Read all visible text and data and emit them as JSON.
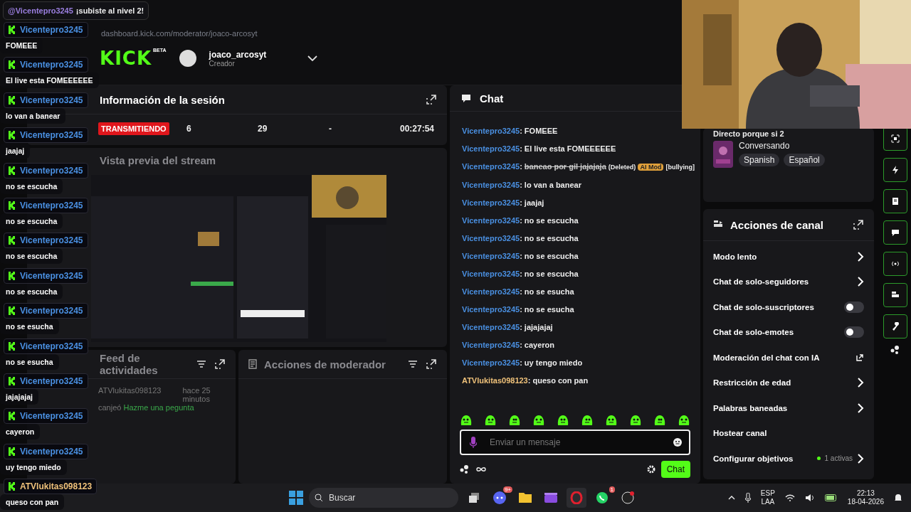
{
  "browser": {
    "url": "dashboard.kick.com/moderator/joaco-arcosyt"
  },
  "header": {
    "logo": "KICK",
    "logo_badge": "BETA",
    "user": {
      "name": "joaco_arcosyt",
      "role": "Creador"
    }
  },
  "session": {
    "title": "Información de la sesión",
    "status": "TRANSMITIENDO",
    "stats": [
      "6",
      "29",
      "-",
      "00:27:54"
    ]
  },
  "preview": {
    "title": "Vista previa del stream"
  },
  "activity": {
    "title": "Feed de actividades",
    "events": [
      {
        "user": "ATVlukitas098123",
        "time": "hace 25 minutos",
        "action": "canjeó",
        "reward": "Hazme una pegunta"
      }
    ]
  },
  "mod_actions": {
    "title": "Acciones de moderador"
  },
  "chat": {
    "title": "Chat",
    "separator": ":",
    "messages": [
      {
        "user": "Vicentepro3245",
        "color": "#4a90e2",
        "text": "FOMEEE",
        "deleted": false
      },
      {
        "user": "Vicentepro3245",
        "color": "#4a90e2",
        "text": "El live esta FOMEEEEEE",
        "deleted": false
      },
      {
        "user": "Vicentepro3245",
        "color": "#4a90e2",
        "text": "baneao por gil jajajaja",
        "deleted": true,
        "deleted_label": "(Deleted)",
        "badge": "AI Mod",
        "reason": "[bullying]"
      },
      {
        "user": "Vicentepro3245",
        "color": "#4a90e2",
        "text": "lo van a banear",
        "deleted": false
      },
      {
        "user": "Vicentepro3245",
        "color": "#4a90e2",
        "text": "jaajaj",
        "deleted": false
      },
      {
        "user": "Vicentepro3245",
        "color": "#4a90e2",
        "text": "no se escucha",
        "deleted": false
      },
      {
        "user": "Vicentepro3245",
        "color": "#4a90e2",
        "text": "no se escucha",
        "deleted": false
      },
      {
        "user": "Vicentepro3245",
        "color": "#4a90e2",
        "text": "no se escucha",
        "deleted": false
      },
      {
        "user": "Vicentepro3245",
        "color": "#4a90e2",
        "text": "no se escucha",
        "deleted": false
      },
      {
        "user": "Vicentepro3245",
        "color": "#4a90e2",
        "text": "no se esucha",
        "deleted": false
      },
      {
        "user": "Vicentepro3245",
        "color": "#4a90e2",
        "text": "no se esucha",
        "deleted": false
      },
      {
        "user": "Vicentepro3245",
        "color": "#4a90e2",
        "text": "jajajajaj",
        "deleted": false
      },
      {
        "user": "Vicentepro3245",
        "color": "#4a90e2",
        "text": "cayeron",
        "deleted": false
      },
      {
        "user": "Vicentepro3245",
        "color": "#4a90e2",
        "text": "uy tengo miedo",
        "deleted": false
      },
      {
        "user": "ATVlukitas098123",
        "color": "#f0c27a",
        "text": "queso con pan",
        "deleted": false
      }
    ],
    "input": {
      "placeholder": "Enviar un mensaje"
    },
    "send_label": "Chat"
  },
  "stream_info": {
    "title": "Directo porque si 2",
    "category": "Conversando",
    "tags": [
      "Spanish",
      "Español"
    ]
  },
  "channel_actions": {
    "title": "Acciones de canal",
    "items": [
      {
        "label": "Modo lento",
        "kind": "link"
      },
      {
        "label": "Chat de solo-seguidores",
        "kind": "link"
      },
      {
        "label": "Chat de solo-suscriptores",
        "kind": "toggle",
        "on": false
      },
      {
        "label": "Chat de solo-emotes",
        "kind": "toggle",
        "on": false
      },
      {
        "label": "Moderación del chat con IA",
        "kind": "external"
      },
      {
        "label": "Restricción de edad",
        "kind": "link"
      },
      {
        "label": "Palabras baneadas",
        "kind": "link"
      },
      {
        "label": "Hostear canal",
        "kind": "plain"
      },
      {
        "label": "Configurar objetivos",
        "kind": "goal",
        "note": "1 activas"
      }
    ]
  },
  "taskbar": {
    "search_placeholder": "Buscar",
    "badges": {
      "discord": "9+",
      "whatsapp": "1"
    },
    "language": "ESP",
    "layout": "LAA",
    "time": "22:13",
    "date": "18-04-2026"
  },
  "overlay": {
    "alert": {
      "mention": "@Vicentepro3245",
      "text": "¡subiste al nivel 2!"
    },
    "messages": [
      {
        "user": "Vicentepro3245",
        "color": "#4a90e2",
        "text": "FOMEEE"
      },
      {
        "user": "Vicentepro3245",
        "color": "#4a90e2",
        "text": "El live esta FOMEEEEEE"
      },
      {
        "user": "Vicentepro3245",
        "color": "#4a90e2",
        "text": "lo van a banear"
      },
      {
        "user": "Vicentepro3245",
        "color": "#4a90e2",
        "text": "jaajaj"
      },
      {
        "user": "Vicentepro3245",
        "color": "#4a90e2",
        "text": "no se escucha"
      },
      {
        "user": "Vicentepro3245",
        "color": "#4a90e2",
        "text": "no se escucha"
      },
      {
        "user": "Vicentepro3245",
        "color": "#4a90e2",
        "text": "no se escucha"
      },
      {
        "user": "Vicentepro3245",
        "color": "#4a90e2",
        "text": "no se escucha"
      },
      {
        "user": "Vicentepro3245",
        "color": "#4a90e2",
        "text": "no se esucha"
      },
      {
        "user": "Vicentepro3245",
        "color": "#4a90e2",
        "text": "no se esucha"
      },
      {
        "user": "Vicentepro3245",
        "color": "#4a90e2",
        "text": "jajajajaj"
      },
      {
        "user": "Vicentepro3245",
        "color": "#4a90e2",
        "text": "cayeron"
      },
      {
        "user": "Vicentepro3245",
        "color": "#4a90e2",
        "text": "uy tengo miedo"
      },
      {
        "user": "ATVlukitas098123",
        "color": "#f0c27a",
        "text": "queso con pan"
      }
    ]
  }
}
